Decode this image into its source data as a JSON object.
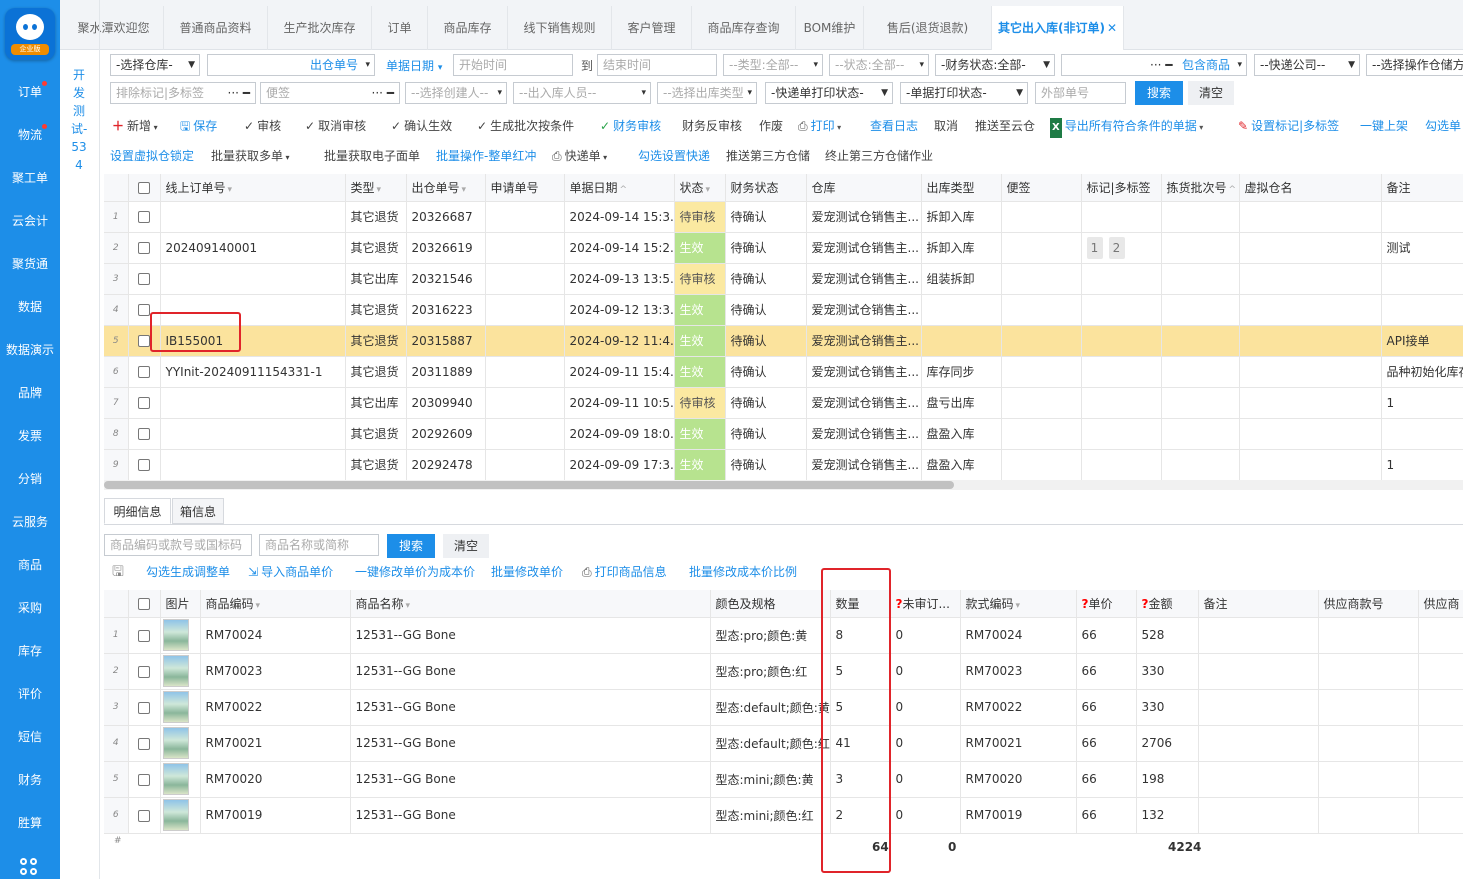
{
  "sidebar": {
    "badge": "企业版",
    "items": [
      "订单",
      "物流",
      "聚工单",
      "云会计",
      "聚货通",
      "数据",
      "数据演示",
      "品牌",
      "发票",
      "分销",
      "云服务",
      "商品",
      "采购",
      "库存",
      "评价",
      "短信",
      "财务",
      "胜算"
    ]
  },
  "panel": {
    "title": "开发测试-534"
  },
  "tabs": [
    "聚水潭欢迎您",
    "普通商品资料",
    "生产批次库存",
    "订单",
    "商品库存",
    "线下销售规则",
    "客户管理",
    "商品库存查询",
    "BOM维护",
    "售后(退货退款)",
    "其它出入库(非订单)"
  ],
  "filters": {
    "warehouse": "-选择仓库-",
    "order_no_label": "出仓单号",
    "date_label": "单据日期",
    "start_time": "开始时间",
    "to": "到",
    "end_time": "结束时间",
    "type": "--类型:全部--",
    "status": "--状态:全部--",
    "finance_status": "-财务状态:全部-",
    "include_goods": "包含商品",
    "express": "--快递公司--",
    "operator_wh": "--选择操作仓储方",
    "exclude_tags": "排除标记|多标签",
    "note": "便签",
    "creator": "--选择创建人--",
    "inout_person": "--出入库人员--",
    "out_type": "--选择出库类型",
    "express_print": "-快递单打印状态-",
    "doc_print": "-单据打印状态-",
    "external_no": "外部单号",
    "search": "搜索",
    "clear": "清空"
  },
  "toolbar1": [
    "新增",
    "保存",
    "审核",
    "取消审核",
    "确认生效",
    "生成批次按条件",
    "财务审核",
    "财务反审核",
    "作废",
    "打印",
    "查看日志",
    "取消",
    "推送至云仓",
    "导出所有符合条件的单据",
    "设置标记|多标签",
    "一键上架",
    "勾选单"
  ],
  "toolbar2": [
    "设置虚拟仓锁定",
    "批量获取多单",
    "批量获取电子面单",
    "批量操作-整单红冲",
    "快递单",
    "勾选设置快递",
    "推送第三方仓储",
    "终止第三方仓储作业"
  ],
  "table": {
    "headers": [
      "线上订单号",
      "类型",
      "出仓单号",
      "申请单号",
      "单据日期",
      "状态",
      "财务状态",
      "仓库",
      "出库类型",
      "便签",
      "标记|多标签",
      "拣货批次号",
      "虚拟仓名",
      "备注"
    ],
    "rows": [
      {
        "idx": "1",
        "online": "",
        "type": "其它退货",
        "no": "20326687",
        "date": "2024-09-14 15:3...",
        "status": "待审核",
        "fin": "待确认",
        "wh": "爱宠测试仓销售主...",
        "out": "拆卸入库",
        "tags": [],
        "remark": ""
      },
      {
        "idx": "2",
        "online": "202409140001",
        "type": "其它退货",
        "no": "20326619",
        "date": "2024-09-14 15:2...",
        "status": "生效",
        "fin": "待确认",
        "wh": "爱宠测试仓销售主...",
        "out": "拆卸入库",
        "tags": [
          "1",
          "2"
        ],
        "remark": "测试"
      },
      {
        "idx": "3",
        "online": "",
        "type": "其它出库",
        "no": "20321546",
        "date": "2024-09-13 13:5...",
        "status": "待审核",
        "fin": "待确认",
        "wh": "爱宠测试仓销售主...",
        "out": "组装拆卸",
        "tags": [],
        "remark": ""
      },
      {
        "idx": "4",
        "online": "",
        "type": "其它退货",
        "no": "20316223",
        "date": "2024-09-12 13:3...",
        "status": "生效",
        "fin": "待确认",
        "wh": "爱宠测试仓销售主...",
        "out": "",
        "tags": [],
        "remark": ""
      },
      {
        "idx": "5",
        "online": "IB155001",
        "type": "其它退货",
        "no": "20315887",
        "date": "2024-09-12 11:4...",
        "status": "生效",
        "fin": "待确认",
        "wh": "爱宠测试仓销售主...",
        "out": "",
        "tags": [],
        "remark": "API接单"
      },
      {
        "idx": "6",
        "online": "YYInit-20240911154331-1",
        "type": "其它退货",
        "no": "20311889",
        "date": "2024-09-11 15:4...",
        "status": "生效",
        "fin": "待确认",
        "wh": "爱宠测试仓销售主...",
        "out": "库存同步",
        "tags": [],
        "remark": "品种初始化库存"
      },
      {
        "idx": "7",
        "online": "",
        "type": "其它出库",
        "no": "20309940",
        "date": "2024-09-11 10:5...",
        "status": "待审核",
        "fin": "待确认",
        "wh": "爱宠测试仓销售主...",
        "out": "盘亏出库",
        "tags": [],
        "remark": "1"
      },
      {
        "idx": "8",
        "online": "",
        "type": "其它退货",
        "no": "20292609",
        "date": "2024-09-09 18:0...",
        "status": "生效",
        "fin": "待确认",
        "wh": "爱宠测试仓销售主...",
        "out": "盘盈入库",
        "tags": [],
        "remark": ""
      },
      {
        "idx": "9",
        "online": "",
        "type": "其它退货",
        "no": "20292478",
        "date": "2024-09-09 17:3...",
        "status": "生效",
        "fin": "待确认",
        "wh": "爱宠测试仓销售主...",
        "out": "盘盈入库",
        "tags": [],
        "remark": "1"
      }
    ]
  },
  "detail": {
    "tabs": [
      "明细信息",
      "箱信息"
    ],
    "code_ph": "商品编码或款号或国标码",
    "name_ph": "商品名称或简称",
    "search": "搜索",
    "clear": "清空",
    "toolbar": [
      "勾选生成调整单",
      "导入商品单价",
      "一键修改单价为成本价",
      "批量修改单价",
      "打印商品信息",
      "批量修改成本价比例"
    ],
    "headers": [
      "图片",
      "商品编码",
      "商品名称",
      "颜色及规格",
      "数量",
      "未审订...",
      "款式编码",
      "单价",
      "金额",
      "备注",
      "供应商款号",
      "供应商"
    ],
    "rows": [
      {
        "idx": "1",
        "code": "RM70024",
        "name": "12531--GG Bone",
        "spec": "型态:pro;颜色:黄",
        "qty": "8",
        "unaudited": "0",
        "style": "RM70024",
        "price": "66",
        "amount": "528"
      },
      {
        "idx": "2",
        "code": "RM70023",
        "name": "12531--GG Bone",
        "spec": "型态:pro;颜色:红",
        "qty": "5",
        "unaudited": "0",
        "style": "RM70023",
        "price": "66",
        "amount": "330"
      },
      {
        "idx": "3",
        "code": "RM70022",
        "name": "12531--GG Bone",
        "spec": "型态:default;颜色:黄",
        "qty": "5",
        "unaudited": "0",
        "style": "RM70022",
        "price": "66",
        "amount": "330"
      },
      {
        "idx": "4",
        "code": "RM70021",
        "name": "12531--GG Bone",
        "spec": "型态:default;颜色:红",
        "qty": "41",
        "unaudited": "0",
        "style": "RM70021",
        "price": "66",
        "amount": "2706"
      },
      {
        "idx": "5",
        "code": "RM70020",
        "name": "12531--GG Bone",
        "spec": "型态:mini;颜色:黄",
        "qty": "3",
        "unaudited": "0",
        "style": "RM70020",
        "price": "66",
        "amount": "198"
      },
      {
        "idx": "6",
        "code": "RM70019",
        "name": "12531--GG Bone",
        "spec": "型态:mini;颜色:红",
        "qty": "2",
        "unaudited": "0",
        "style": "RM70019",
        "price": "66",
        "amount": "132"
      }
    ],
    "footer": {
      "hash": "#",
      "qty": "64",
      "unaudited": "0",
      "amount": "4224"
    }
  },
  "colors": {
    "primary": "#1d8ee8",
    "pending": "#fbe9a1",
    "active": "#b7e38f",
    "highlight": "#fbe39d",
    "annotation": "#e0242a"
  }
}
